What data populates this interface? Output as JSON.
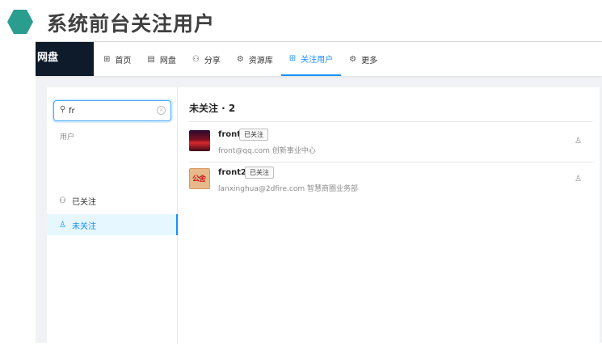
{
  "slide": {
    "title": "系统前台关注用户"
  },
  "brand": {
    "label": "网盘"
  },
  "nav": [
    {
      "icon": "grid-icon",
      "glyph": "⊞",
      "label": "首页"
    },
    {
      "icon": "layout-icon",
      "glyph": "▤",
      "label": "网盘"
    },
    {
      "icon": "share-icon",
      "glyph": "⚇",
      "label": "分享"
    },
    {
      "icon": "gear-icon",
      "glyph": "⚙",
      "label": "资源库"
    },
    {
      "icon": "grid-icon",
      "glyph": "⊞",
      "label": "关注用户",
      "active": true
    },
    {
      "icon": "gear-icon",
      "glyph": "⚙",
      "label": "更多"
    }
  ],
  "sidebar": {
    "search": {
      "value": "fr",
      "placeholder": ""
    },
    "group_label": "用户",
    "items": [
      {
        "icon": "users-icon",
        "glyph": "⚇",
        "label": "已关注"
      },
      {
        "icon": "user-icon",
        "glyph": "♙",
        "label": "未关注",
        "active": true
      }
    ]
  },
  "main": {
    "title": "未关注 · 2",
    "users": [
      {
        "name": "front",
        "tag": "已关注",
        "desc": "front@qq.com 创新事业中心",
        "avatar": "photo-avatar",
        "action_icon": "user-icon",
        "action_glyph": "♙"
      },
      {
        "name": "front2",
        "tag": "已关注",
        "desc": "lanxinghua@2dfire.com 智慧商圈业务部",
        "avatar": "seal-avatar",
        "action_icon": "user-icon",
        "action_glyph": "♙"
      }
    ]
  },
  "colors": {
    "accent": "#1890ff",
    "brand_bg": "#0d1b2a",
    "hex": "#2a9d8f"
  }
}
